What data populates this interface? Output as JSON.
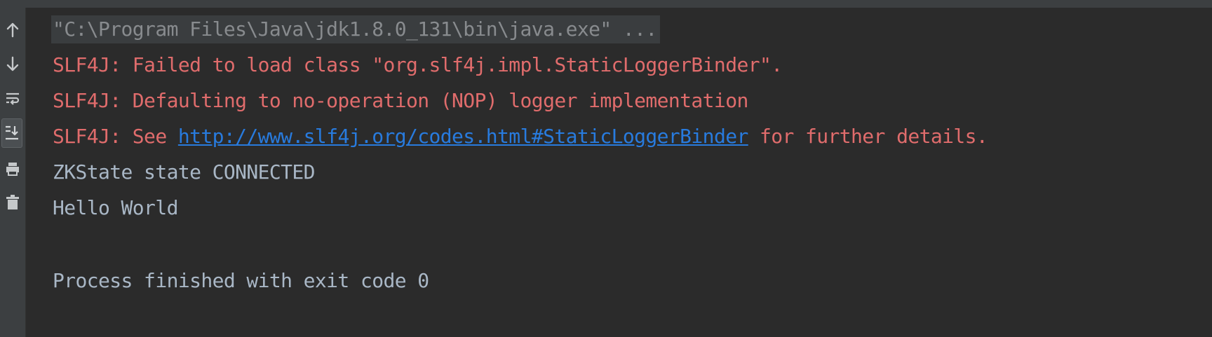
{
  "toolbar": {
    "buttons": [
      {
        "icon": "arrow-up-icon",
        "name": "scroll-up"
      },
      {
        "icon": "arrow-down-icon",
        "name": "scroll-down"
      },
      {
        "icon": "soft-wrap-icon",
        "name": "soft-wraps"
      },
      {
        "icon": "scroll-to-end-icon",
        "name": "scroll-to-end"
      },
      {
        "icon": "print-icon",
        "name": "print"
      },
      {
        "icon": "trash-icon",
        "name": "clear-all"
      }
    ]
  },
  "console": {
    "command_line": "\"C:\\Program Files\\Java\\jdk1.8.0_131\\bin\\java.exe\" ...",
    "err_line_1": "SLF4J: Failed to load class \"org.slf4j.impl.StaticLoggerBinder\".",
    "err_line_2": "SLF4J: Defaulting to no-operation (NOP) logger implementation",
    "err_line_3_prefix": "SLF4J: See ",
    "err_line_3_link": "http://www.slf4j.org/codes.html#StaticLoggerBinder",
    "err_line_3_suffix": " for further details.",
    "out_line_1": "ZKState state CONNECTED",
    "out_line_2": "Hello World",
    "exit_line": "Process finished with exit code 0"
  },
  "colors": {
    "background": "#2b2b2b",
    "gutter": "#3c3f41",
    "stdout": "#a9b7c6",
    "stderr": "#e06c6c",
    "link": "#287bde",
    "command": "#888b8e"
  }
}
